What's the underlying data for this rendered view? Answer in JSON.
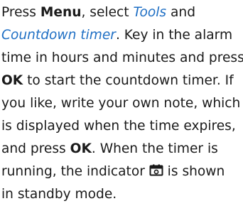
{
  "paragraph": {
    "l1_a": "Press ",
    "l1_menu": "Menu",
    "l1_b": ", select ",
    "l1_tools": "Tools",
    "l1_c": " and",
    "l2_countdown": "Countdown timer",
    "l2_a": ". Key in the alarm",
    "l3": "time in hours and minutes and press",
    "l4_ok": "OK",
    "l4_a": " to start the countdown timer. If",
    "l5": "you like, write your own note, which",
    "l6": "is displayed when the time expires,",
    "l7_a": "and press ",
    "l7_ok": "OK",
    "l7_b": ". When the timer is",
    "l8_a": "running, the indicator ",
    "l8_b": " is shown",
    "l9": "in standby mode."
  },
  "indicator_icon": "countdown-timer-indicator",
  "colors": {
    "text": "#1a1a1a",
    "link": "#1f6fc4"
  }
}
